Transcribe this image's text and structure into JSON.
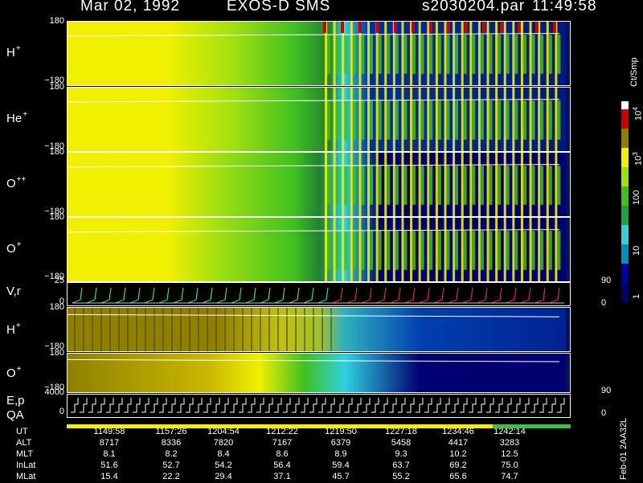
{
  "header": {
    "date": "Mar 02, 1992",
    "instrument": "EXOS-D SMS",
    "file": "s2030204.par",
    "time": "11:49:58"
  },
  "panels": [
    {
      "id": "h-spin",
      "label": "H",
      "charge": "+",
      "ymax": "180",
      "ymin": "−180"
    },
    {
      "id": "he-spin",
      "label": "He",
      "charge": "+",
      "ymax": "180",
      "ymin": "−180"
    },
    {
      "id": "opp-spin",
      "label": "O",
      "charge": "++",
      "ymax": "180",
      "ymin": "−180"
    },
    {
      "id": "op-spin",
      "label": "O",
      "charge": "+",
      "ymax": "180",
      "ymin": "−180"
    }
  ],
  "vr_panel": {
    "label": "V,r",
    "ymax": "25",
    "ymin": "0",
    "rmax": "90",
    "rmin": "0"
  },
  "pitch_panels": [
    {
      "id": "h-pitch",
      "label": "H",
      "charge": "+",
      "ymax": "180",
      "ymin": "−180"
    },
    {
      "id": "op-pitch",
      "label": "O",
      "charge": "+",
      "ymax": "180",
      "ymin": "−180"
    }
  ],
  "ep_panel": {
    "label1": "E,p",
    "label2": "QA",
    "ymax": "4000",
    "ymin": "0",
    "rmax": "90",
    "rmin": "0"
  },
  "colorbar": {
    "unit": "Ct/Smp",
    "ticks": [
      "1",
      "10",
      "100",
      "10",
      "10"
    ],
    "tick_exponents": [
      "",
      "",
      "",
      "3",
      "4"
    ],
    "colors": [
      "#000070",
      "#0000a0",
      "#0090c0",
      "#30d0e0",
      "#20a040",
      "#40c020",
      "#a0e010",
      "#f0f000",
      "#908000",
      "#d00000"
    ]
  },
  "footer_table": {
    "rows": [
      {
        "label": "UT",
        "values": [
          "1149:58",
          "1157:26",
          "1204:54",
          "1212:22",
          "1219:50",
          "1227:18",
          "1234:46",
          "1242:14"
        ]
      },
      {
        "label": "ALT",
        "values": [
          "8717",
          "8336",
          "7820",
          "7167",
          "6379",
          "5458",
          "4417",
          "3283"
        ]
      },
      {
        "label": "MLT",
        "values": [
          "8.1",
          "8.2",
          "8.4",
          "8.6",
          "8.9",
          "9.3",
          "10.2",
          "12.5"
        ]
      },
      {
        "label": "InLat",
        "values": [
          "51.6",
          "52.7",
          "54.2",
          "56.4",
          "59.4",
          "63.7",
          "69.2",
          "75.0"
        ]
      },
      {
        "label": "MLat",
        "values": [
          "15.4",
          "22.2",
          "29.4",
          "37.1",
          "45.7",
          "55.2",
          "65.6",
          "74.7"
        ]
      }
    ]
  },
  "side_label": "Feb-01 2AA32L",
  "chart_data": {
    "type": "heatmap",
    "x_ticks": [
      "1149:58",
      "1157:26",
      "1204:54",
      "1212:22",
      "1219:50",
      "1227:18",
      "1234:46",
      "1242:14"
    ],
    "color_scale": "log",
    "zlabel": "Ct/Smp",
    "zlim": [
      1,
      10000
    ],
    "series": [
      {
        "name": "H+",
        "ylim": [
          -180,
          180
        ],
        "y_label": "H+"
      },
      {
        "name": "He+",
        "ylim": [
          -180,
          180
        ],
        "y_label": "He+"
      },
      {
        "name": "O++",
        "ylim": [
          -180,
          180
        ],
        "y_label": "O++"
      },
      {
        "name": "O+",
        "ylim": [
          -180,
          180
        ],
        "y_label": "O+"
      },
      {
        "name": "V,r",
        "ylim": [
          0,
          25
        ],
        "y2lim": [
          0,
          90
        ]
      },
      {
        "name": "H+ pitch",
        "ylim": [
          -180,
          180
        ]
      },
      {
        "name": "O+ pitch",
        "ylim": [
          -180,
          180
        ]
      },
      {
        "name": "E,p",
        "ylim": [
          0,
          4000
        ],
        "y2lim": [
          0,
          90
        ]
      }
    ]
  }
}
